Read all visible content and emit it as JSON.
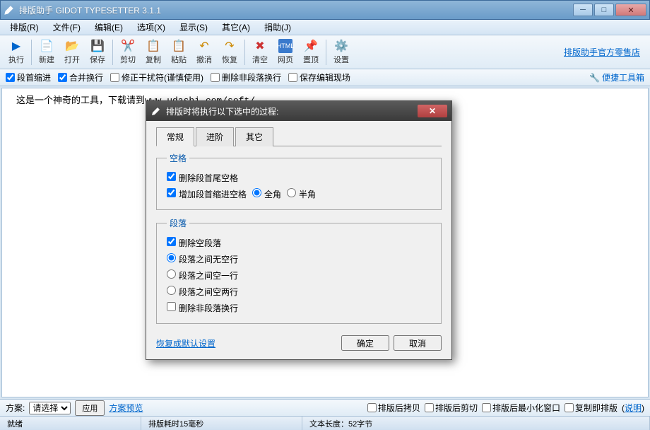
{
  "window": {
    "title": "排版助手 GIDOT TYPESETTER 3.1.1"
  },
  "menu": {
    "typeset": "排版(R)",
    "file": "文件(F)",
    "edit": "编辑(E)",
    "options": "选项(X)",
    "display": "显示(S)",
    "other": "其它(A)",
    "donate": "捐助(J)"
  },
  "toolbar": {
    "run": "执行",
    "new": "新建",
    "open": "打开",
    "save": "保存",
    "cut": "剪切",
    "copy": "复制",
    "paste": "粘贴",
    "undo": "撤消",
    "redo": "恢复",
    "clear": "清空",
    "web": "网页",
    "top": "置顶",
    "settings": "设置",
    "shop": "排版助手官方零售店"
  },
  "opts": {
    "indent": "段首缩进",
    "merge": "合并换行",
    "fix": "修正干扰符(谨慎使用)",
    "delNonPara": "删除非段落换行",
    "saveScene": "保存编辑现场",
    "toolbox": "便捷工具箱"
  },
  "editor": {
    "text": "这是一个神奇的工具，下载请到www.udashi.com/soft/"
  },
  "bottom": {
    "schemeLabel": "方案:",
    "schemePlaceholder": "请选择",
    "apply": "应用",
    "preview": "方案预览",
    "copyAfter": "排版后拷贝",
    "cutAfter": "排版后剪切",
    "minAfter": "排版后最小化窗口",
    "copyType": "复制即排版",
    "explain": "说明"
  },
  "status": {
    "ready": "就绪",
    "timing": "排版耗时15毫秒",
    "length": "文本长度：52字节"
  },
  "dialog": {
    "title": "排版时将执行以下选中的过程:",
    "tabs": {
      "normal": "常规",
      "advanced": "进阶",
      "other": "其它"
    },
    "space": {
      "legend": "空格",
      "trimEnds": "删除段首尾空格",
      "addIndent": "增加段首缩进空格",
      "fullWidth": "全角",
      "halfWidth": "半角"
    },
    "para": {
      "legend": "段落",
      "delEmpty": "删除空段落",
      "noBlank": "段落之间无空行",
      "oneBlank": "段落之间空一行",
      "twoBlank": "段落之间空两行",
      "delNonPara": "删除非段落换行"
    },
    "restore": "恢复成默认设置",
    "ok": "确定",
    "cancel": "取消"
  }
}
